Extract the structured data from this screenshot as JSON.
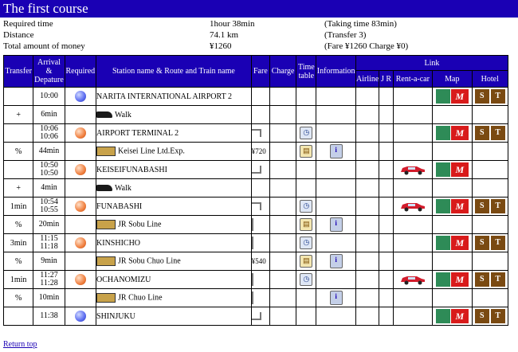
{
  "title": "The first course",
  "summary": {
    "required_label": "Required time",
    "required_value": "1hour 38min",
    "taking_time": "(Taking time  83min)",
    "distance_label": "Distance",
    "distance_value": "74.1 km",
    "transfer": "(Transfer   3)",
    "money_label": "Total amount of money",
    "money_value": "¥1260",
    "fare_charge": "(Fare ¥1260   Charge ¥0)"
  },
  "headers": {
    "transfer": "Transfer",
    "arrival_departure": "Arrival & Depature",
    "required": "Required",
    "station": "Station name & Route and Train name",
    "fare": "Fare",
    "charge": "Charge",
    "timetable": "Time table",
    "information": "Information",
    "link": "Link",
    "airline": "Airline",
    "jr": "J R",
    "rent_a_car": "Rent-a-car",
    "map": "Map",
    "hotel": "Hotel"
  },
  "rows": [
    {
      "type": "station",
      "transfer": "",
      "time": "10:00",
      "ball": "blue",
      "name": "NARITA INTERNATIONAL AIRPORT 2",
      "fare": "",
      "line": "",
      "timetable": false,
      "rentacar": false,
      "map": true,
      "hotel": true
    },
    {
      "type": "route",
      "transfer": "+",
      "time": "6min",
      "route": "Walk",
      "icon": "walk",
      "fare": "",
      "line": "",
      "timetable": false,
      "info": false
    },
    {
      "type": "station",
      "transfer": "",
      "time": "10:06\n10:06",
      "ball": "orange",
      "name": "AIRPORT TERMINAL 2",
      "fare": "",
      "line": "top",
      "timetable": true,
      "rentacar": false,
      "map": true,
      "hotel": true
    },
    {
      "type": "route",
      "transfer": "%",
      "time": "44min",
      "route": "Keisei Line Ltd.Exp.",
      "icon": "train",
      "fare": "¥720",
      "line": "",
      "timetable": true,
      "info": true
    },
    {
      "type": "station",
      "transfer": "",
      "time": "10:50\n10:50",
      "ball": "orange",
      "name": "KEISEIFUNABASHI",
      "fare": "",
      "line": "bot",
      "timetable": false,
      "rentacar": true,
      "map": true,
      "hotel": false
    },
    {
      "type": "route",
      "transfer": "+",
      "time": "4min",
      "route": "Walk",
      "icon": "walk",
      "fare": "",
      "line": "",
      "timetable": false,
      "info": false
    },
    {
      "type": "station",
      "transfer": "1min",
      "time": "10:54\n10:55",
      "ball": "orange",
      "name": "FUNABASHI",
      "fare": "",
      "line": "top",
      "timetable": true,
      "rentacar": true,
      "map": true,
      "hotel": true
    },
    {
      "type": "route",
      "transfer": "%",
      "time": "20min",
      "route": "JR Sobu Line",
      "icon": "train",
      "fare": "",
      "line": "bar",
      "timetable": true,
      "info": true
    },
    {
      "type": "station",
      "transfer": "3min",
      "time": "11:15\n11:18",
      "ball": "orange",
      "name": "KINSHICHO",
      "fare": "",
      "line": "bar",
      "timetable": true,
      "rentacar": false,
      "map": true,
      "hotel": true
    },
    {
      "type": "route",
      "transfer": "%",
      "time": "9min",
      "route": "JR Sobu Chuo Line",
      "icon": "train",
      "fare": "¥540",
      "line": "bar",
      "timetable": true,
      "info": true
    },
    {
      "type": "station",
      "transfer": "1min",
      "time": "11:27\n11:28",
      "ball": "orange",
      "name": "OCHANOMIZU",
      "fare": "",
      "line": "bar",
      "timetable": true,
      "rentacar": true,
      "map": true,
      "hotel": true
    },
    {
      "type": "route",
      "transfer": "%",
      "time": "10min",
      "route": "JR Chuo Line",
      "icon": "train",
      "fare": "",
      "line": "bar",
      "timetable": false,
      "info": true
    },
    {
      "type": "station",
      "transfer": "",
      "time": "11:38",
      "ball": "blue",
      "name": "SHINJUKU",
      "fare": "",
      "line": "bot",
      "timetable": false,
      "rentacar": false,
      "map": true,
      "hotel": true
    }
  ],
  "return_link": "Return top"
}
